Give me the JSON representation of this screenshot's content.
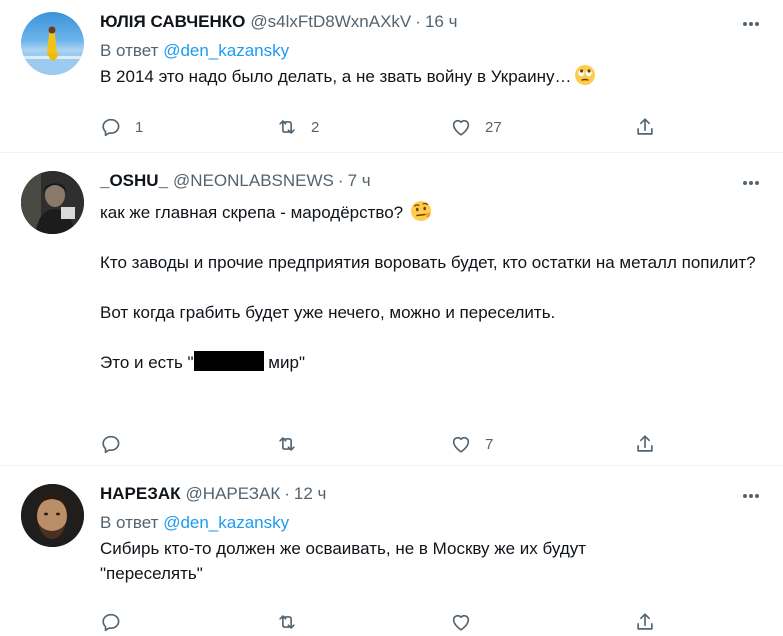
{
  "tweets": [
    {
      "name": "ЮЛІЯ САВЧЕНКО",
      "handle": "@s4lxFtD8WxnAXkV",
      "dot": "·",
      "time": "16 ч",
      "reply_prefix": "В ответ",
      "reply_to": "@den_kazansky",
      "text": "В 2014 это надо было делать, а не звать войну в Украину…",
      "emoji_icon": "face-with-rolling-eyes",
      "replies": "1",
      "retweets": "2",
      "likes": "27"
    },
    {
      "name": "_OSHU_",
      "handle": "@NEONLABSNEWS",
      "dot": "·",
      "time": "7 ч",
      "text_p1": "как же главная скрепа - мародёрство?",
      "emoji_icon": "face-with-raised-eyebrow",
      "text_p2": "Кто заводы и прочие предприятия воровать будет, кто остатки на металл попилит?",
      "text_p3": "Вот когда грабить будет уже нечего, можно и переселить.",
      "text_p4_start": "Это и есть \"",
      "text_p4_end": " мир\"",
      "replies": "",
      "retweets": "",
      "likes": "7"
    },
    {
      "name": "НАРЕЗАК",
      "handle": "@НАРЕЗАК",
      "dot": "·",
      "time": "12 ч",
      "reply_prefix": "В ответ",
      "reply_to": "@den_kazansky",
      "text_line1": "Сибирь кто-то должен же осваивать, не в Москву же их будут",
      "text_line2": "\"переселять\"",
      "replies": "",
      "retweets": "",
      "likes": ""
    }
  ],
  "colors": {
    "text": "#0f1419",
    "secondary": "#536471",
    "link": "#1d9bf0",
    "border": "#eff3f4"
  }
}
